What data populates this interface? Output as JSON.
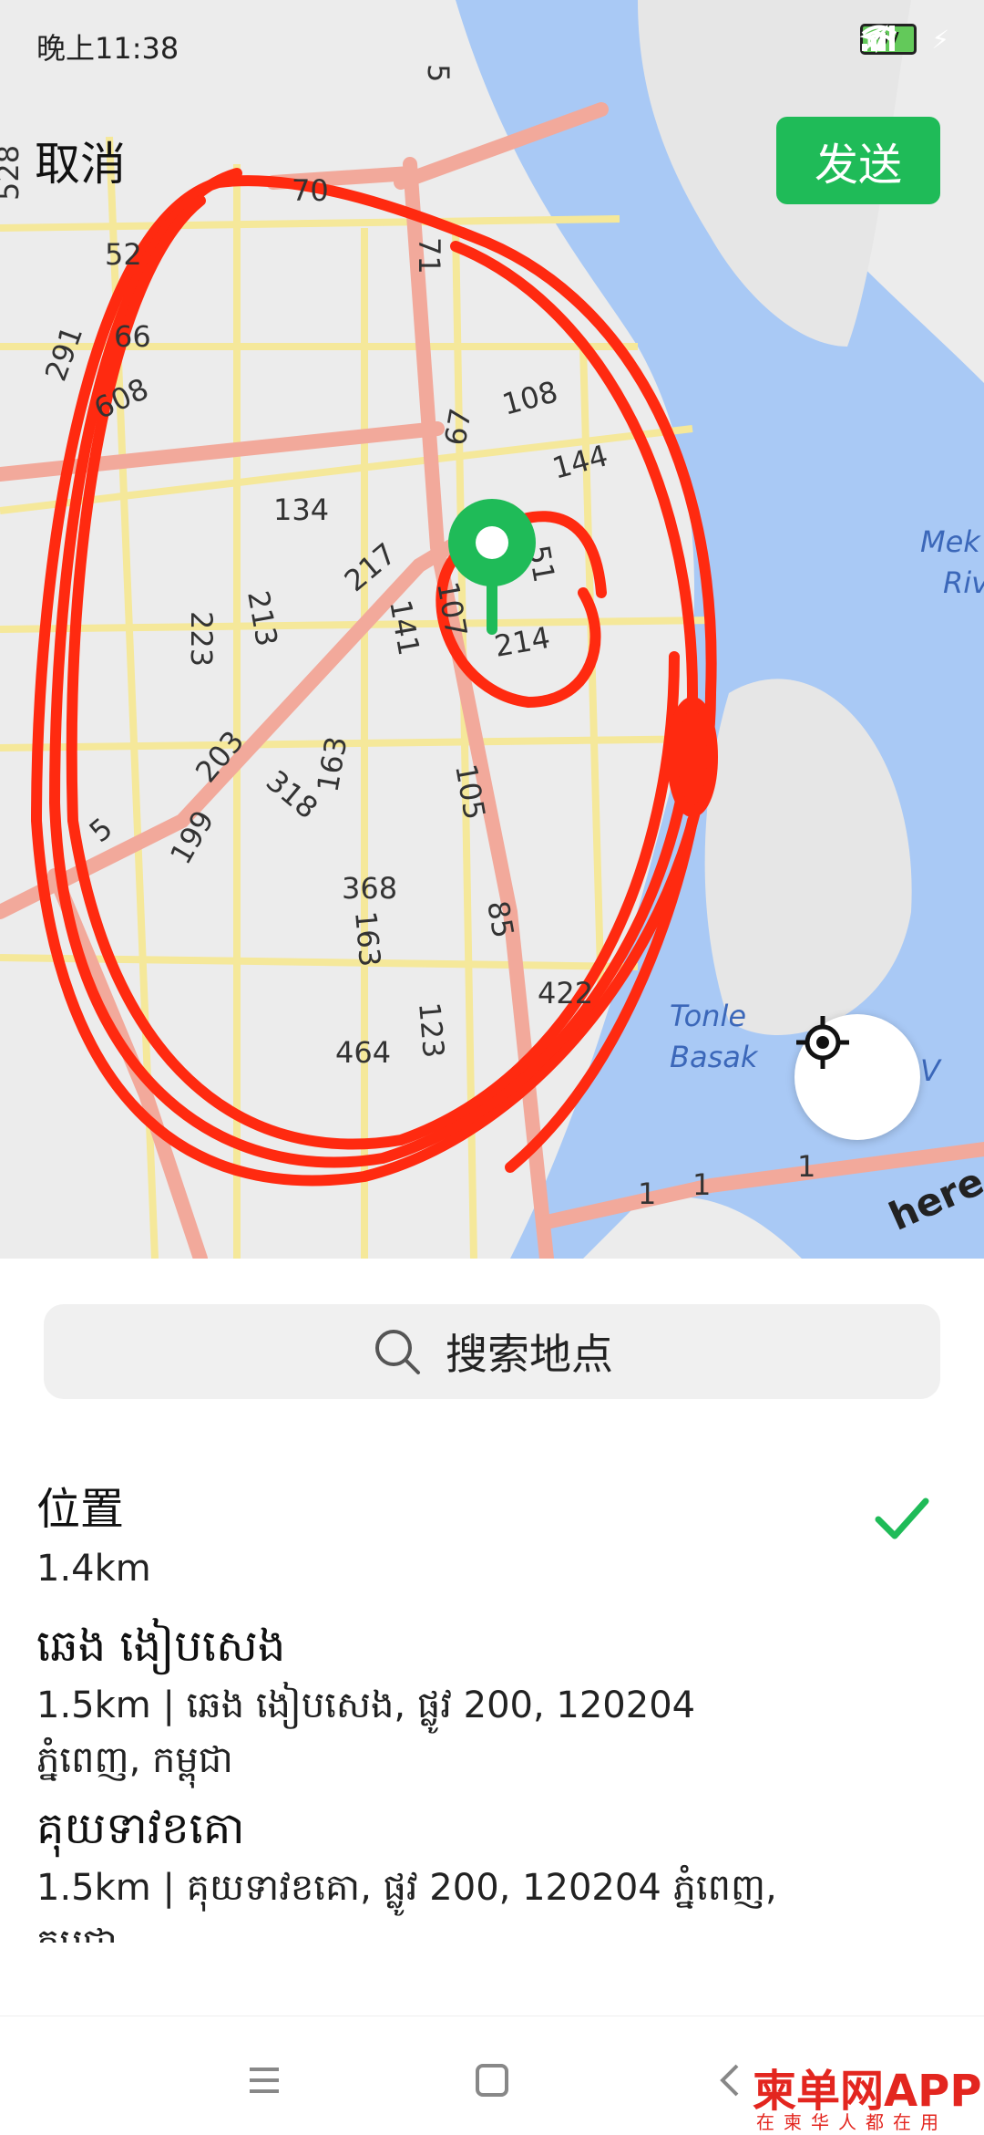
{
  "status_bar": {
    "time": "晚上11:38",
    "battery": "97"
  },
  "top_bar": {
    "cancel_label": "取消",
    "send_label": "发送"
  },
  "map": {
    "road_labels": [
      "5",
      "70",
      "528",
      "291",
      "608",
      "66",
      "52",
      "71",
      "67",
      "108",
      "144",
      "134",
      "217",
      "223",
      "213",
      "141",
      "107",
      "214",
      "51",
      "163",
      "203",
      "318",
      "199",
      "105",
      "368",
      "163",
      "85",
      "422",
      "123",
      "464",
      "1",
      "1",
      "1",
      "5"
    ],
    "water_labels": {
      "mekong": "Mek",
      "mekong2": "Riv",
      "tonle1": "Tonle",
      "tonle2": "Basak",
      "v": "V"
    },
    "provider": "here",
    "colors": {
      "land": "#ececec",
      "water": "#a9c9f5",
      "major_road": "#f2a99b",
      "minor_road": "#f5e89a",
      "pin": "#1fbb58",
      "annotation": "#ff2a10"
    }
  },
  "search": {
    "placeholder": "搜索地点"
  },
  "locations": [
    {
      "title": "位置",
      "subtitle_line1": "1.4km",
      "subtitle_line2": "",
      "selected": true
    },
    {
      "title": "ឆេង ងៀបសេង",
      "subtitle_line1": "1.5km | ឆេង ងៀបសេង, ផ្លូវ 200, 120204",
      "subtitle_line2": "ភ្នំពេញ, កម្ពុជា",
      "selected": false
    },
    {
      "title": "គុយទាវខគោ",
      "subtitle_line1": "1.5km | គុយទាវខគោ, ផ្លូវ 200, 120204 ភ្នំពេញ,",
      "subtitle_line2": "កម្ពុជា",
      "selected": false
    }
  ],
  "watermark": {
    "brand": "柬单网APP",
    "tagline": "在柬华人都在用"
  }
}
